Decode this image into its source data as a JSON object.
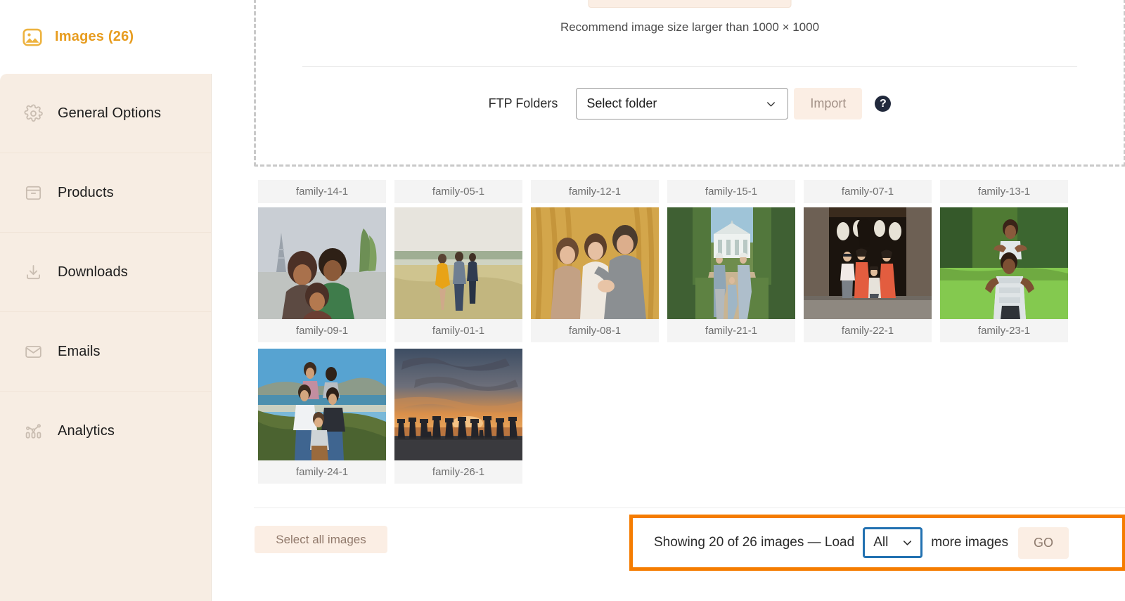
{
  "sidebar": {
    "header": {
      "label": "Images (26)",
      "icon": "image-icon"
    },
    "items": [
      {
        "label": "General Options",
        "icon": "gear-icon"
      },
      {
        "label": "Products",
        "icon": "archive-box-icon"
      },
      {
        "label": "Downloads",
        "icon": "download-icon"
      },
      {
        "label": "Emails",
        "icon": "envelope-icon"
      },
      {
        "label": "Analytics",
        "icon": "analytics-icon"
      }
    ]
  },
  "dropzone": {
    "recommend_text": "Recommend image size larger than 1000 × 1000",
    "ftp_label": "FTP Folders",
    "ftp_select_value": "Select folder",
    "ftp_options": [
      "Select folder"
    ],
    "import_label": "Import",
    "help_glyph": "?"
  },
  "grid": {
    "top_captions": [
      "family-14-1",
      "family-05-1",
      "family-12-1",
      "family-15-1",
      "family-07-1",
      "family-13-1"
    ],
    "rows": [
      [
        {
          "caption": "family-09-1",
          "scene": "paris-eiffel-family"
        },
        {
          "caption": "family-01-1",
          "scene": "meadow-couple-yellow-dress"
        },
        {
          "caption": "family-08-1",
          "scene": "autumn-golden-trio"
        },
        {
          "caption": "family-21-1",
          "scene": "garden-path-conservatory"
        },
        {
          "caption": "family-22-1",
          "scene": "temple-doorway-red-dresses"
        },
        {
          "caption": "family-23-1",
          "scene": "green-lawn-shoulder-ride"
        }
      ],
      [
        {
          "caption": "family-24-1",
          "scene": "coastal-hillside-family"
        },
        {
          "caption": "family-26-1",
          "scene": "beach-sunset-silhouettes"
        }
      ]
    ]
  },
  "footer": {
    "select_all_label": "Select all images",
    "showing_text": "Showing 20 of 26 images — Load",
    "load_value": "All",
    "load_options": [
      "All"
    ],
    "more_text": "more images",
    "go_label": "GO"
  },
  "colors": {
    "accent_orange": "#e79c1f",
    "highlight_orange": "#f57c00",
    "select_blue": "#2271b1",
    "sidebar_cream": "#f7ede3",
    "button_peach": "#fbeee4"
  }
}
